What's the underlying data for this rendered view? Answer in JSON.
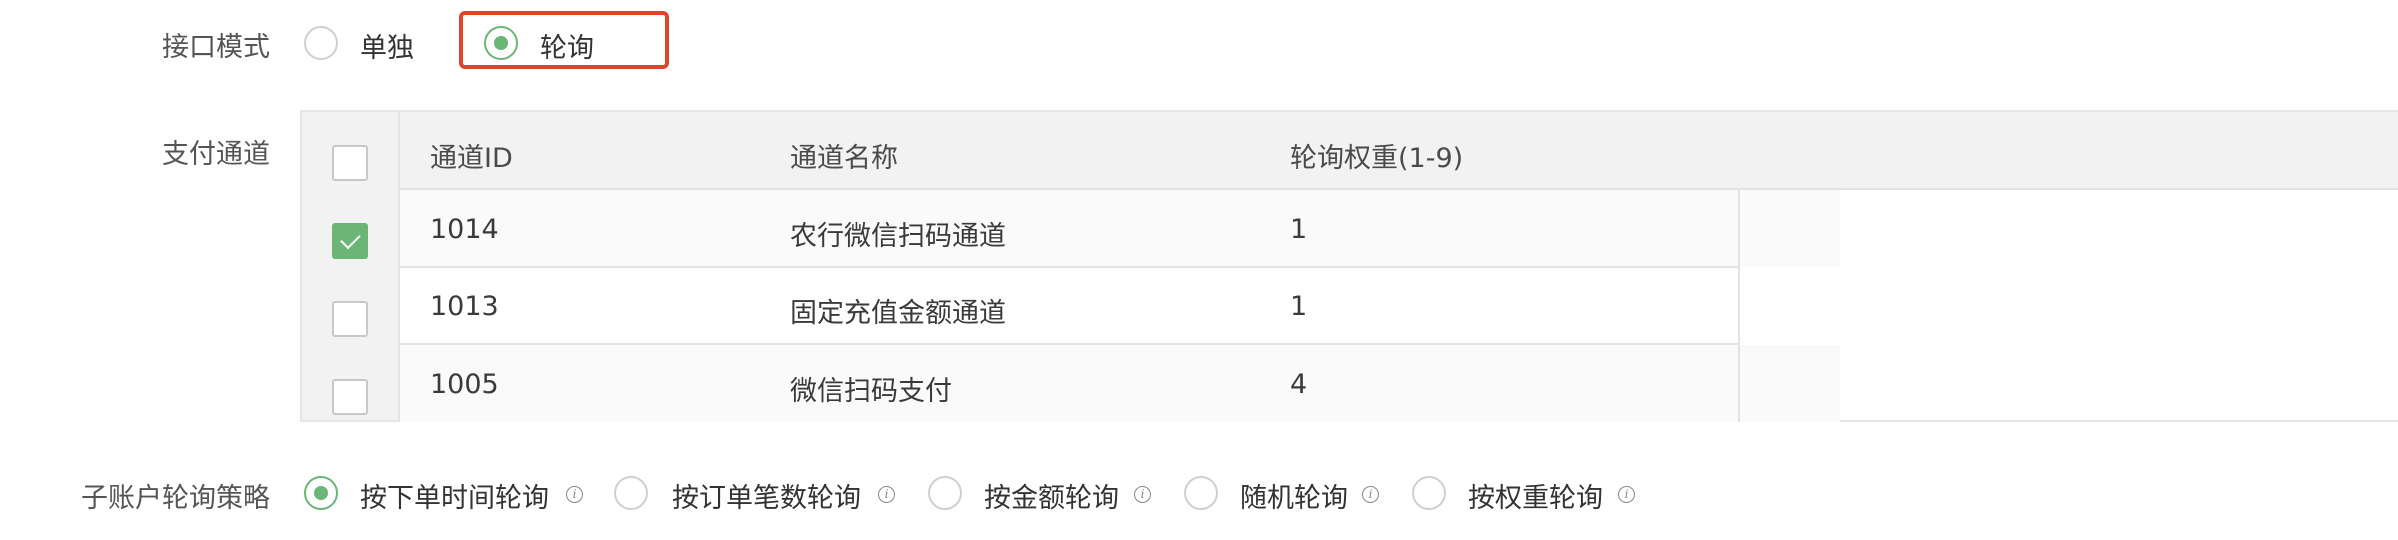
{
  "interface_mode": {
    "label": "接口模式",
    "options": [
      {
        "label": "单独",
        "checked": false
      },
      {
        "label": "轮询",
        "checked": true
      }
    ]
  },
  "payment_channels": {
    "label": "支付通道",
    "columns": [
      "通道ID",
      "通道名称",
      "轮询权重(1-9)"
    ],
    "header_checked": false,
    "rows": [
      {
        "checked": true,
        "id": "1014",
        "name": "农行微信扫码通道",
        "weight": "1"
      },
      {
        "checked": false,
        "id": "1013",
        "name": "固定充值金额通道",
        "weight": "1"
      },
      {
        "checked": false,
        "id": "1005",
        "name": "微信扫码支付",
        "weight": "4"
      }
    ]
  },
  "polling_strategy": {
    "label": "子账户轮询策略",
    "options": [
      {
        "label": "按下单时间轮询",
        "checked": true
      },
      {
        "label": "按订单笔数轮询",
        "checked": false
      },
      {
        "label": "按金额轮询",
        "checked": false
      },
      {
        "label": "随机轮询",
        "checked": false
      },
      {
        "label": "按权重轮询",
        "checked": false
      }
    ]
  },
  "colors": {
    "accent": "#6bb576",
    "highlight": "#e0442a",
    "header_bg": "#f2f2f2"
  }
}
